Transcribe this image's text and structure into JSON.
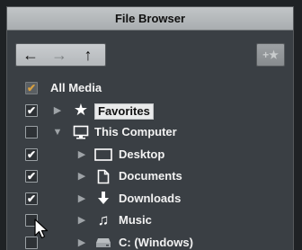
{
  "window": {
    "title": "File Browser"
  },
  "toolbar": {
    "back_glyph": "←",
    "forward_glyph": "→",
    "up_glyph": "↑",
    "add_favorite_glyph": "+★"
  },
  "tree": {
    "all_media": {
      "label": "All Media",
      "checked": true,
      "checkbox_glyph": "✔"
    },
    "favorites": {
      "label": "Favorites",
      "checked": true,
      "checkbox_glyph": "✔",
      "icon": "star-icon"
    },
    "this_computer": {
      "label": "This Computer",
      "checked": false,
      "checkbox_glyph": "",
      "icon": "monitor-icon"
    },
    "desktop": {
      "label": "Desktop",
      "checked": true,
      "checkbox_glyph": "✔",
      "icon": "desktop-icon"
    },
    "documents": {
      "label": "Documents",
      "checked": true,
      "checkbox_glyph": "✔",
      "icon": "document-icon"
    },
    "downloads": {
      "label": "Downloads",
      "checked": true,
      "checkbox_glyph": "✔",
      "icon": "download-icon"
    },
    "music": {
      "label": "Music",
      "checked": false,
      "checkbox_glyph": "",
      "icon": "music-note-icon"
    },
    "c_drive": {
      "label": "C: (Windows)",
      "checked": false,
      "checkbox_glyph": "",
      "icon": "drive-icon"
    }
  },
  "icons": {
    "collapsed": "▶",
    "expanded": "▼",
    "star": "★",
    "music": "♫"
  }
}
